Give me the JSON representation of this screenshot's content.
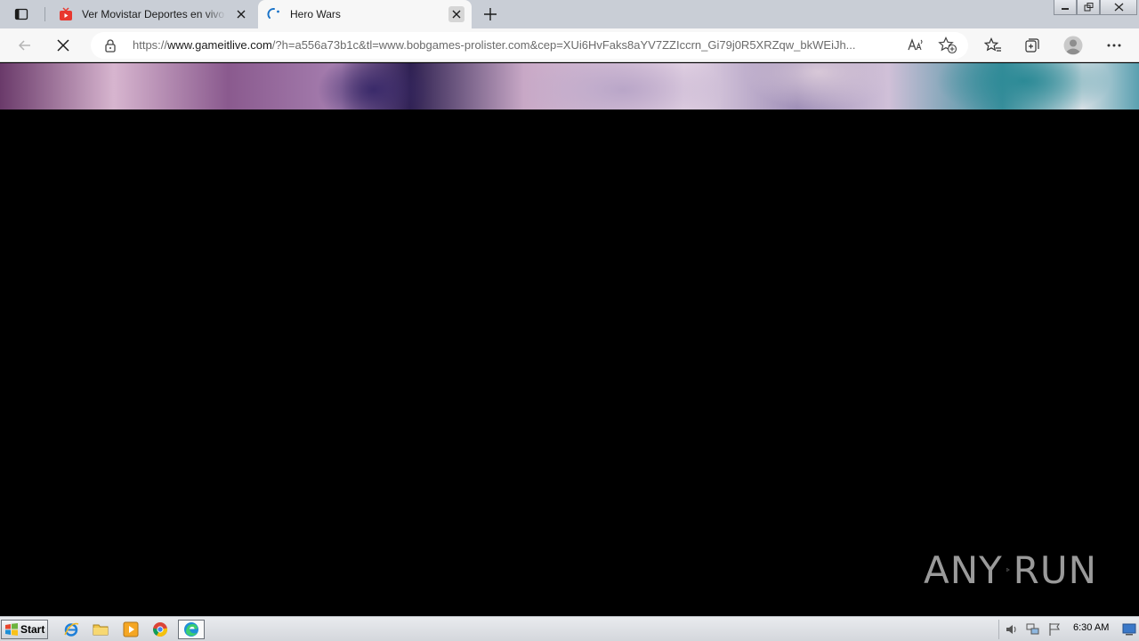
{
  "browser": {
    "tabs": [
      {
        "title": "Ver Movistar Deportes en vivo online",
        "active": false,
        "favicon": "tv-icon"
      },
      {
        "title": "Hero Wars",
        "active": true,
        "favicon": "loading-spinner-icon"
      }
    ],
    "address": {
      "url_prefix": "https://",
      "url_domain": "www.gameitlive.com",
      "url_rest": "/?h=a556a73b1c&tl=www.bobgames-prolister.com&cep=XUi6HvFaks8aYV7ZZIccrn_Gi79j0R5XRZqw_bkWEiJh..."
    }
  },
  "page": {
    "watermark_left": "ANY",
    "watermark_right": "RUN"
  },
  "taskbar": {
    "start_label": "Start",
    "clock": "6:30 AM"
  },
  "colors": {
    "tabstrip": "#c9ced6",
    "toolbar": "#f7f7f7",
    "page_bg": "#000000",
    "watermark": "#9a9a9a"
  }
}
